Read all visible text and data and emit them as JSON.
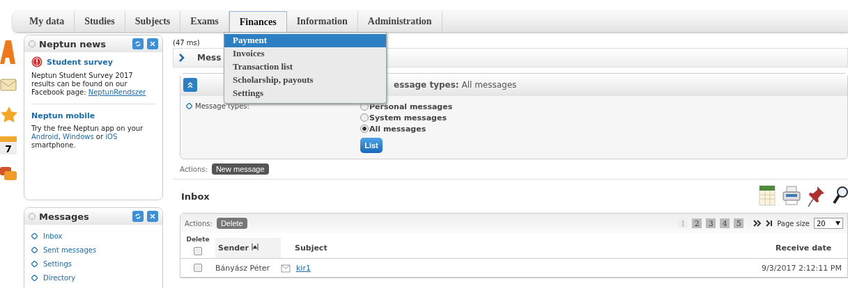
{
  "nav": {
    "tabs": [
      {
        "label": "My data",
        "selected": false
      },
      {
        "label": "Studies",
        "selected": false
      },
      {
        "label": "Subjects",
        "selected": false
      },
      {
        "label": "Exams",
        "selected": false
      },
      {
        "label": "Finances",
        "selected": true
      },
      {
        "label": "Information",
        "selected": false
      },
      {
        "label": "Administration",
        "selected": false
      }
    ],
    "dropdown": [
      {
        "label": "Payment",
        "selected": true
      },
      {
        "label": "Invoices",
        "selected": false
      },
      {
        "label": "Transaction list",
        "selected": false
      },
      {
        "label": "Scholarship, payouts",
        "selected": false
      },
      {
        "label": "Settings",
        "selected": false
      }
    ]
  },
  "side_icons": {
    "calendar_day": "7"
  },
  "news_box": {
    "title": "Neptun news",
    "items": [
      {
        "kind": "alert",
        "title": "Student survey",
        "text": "Neptun Student Survey 2017 results can be found on our Facebook page: ",
        "link": "NeptunRendszer"
      },
      {
        "kind": "plain",
        "title": "Neptun mobile",
        "parts": [
          "Try the free Neptun app on your ",
          "Android",
          ", ",
          "Windows",
          " or ",
          "iOS",
          " smartphone."
        ]
      }
    ]
  },
  "messages_box": {
    "title": "Messages",
    "links": [
      "Inbox",
      "Sent messages",
      "Settings",
      "Directory"
    ]
  },
  "timing": "(47 ms)",
  "panel_title": "Mess",
  "filter": {
    "summary_label": "essage types:",
    "summary_value": "All messages",
    "label": "Message types:",
    "options": [
      {
        "label": "Personal messages",
        "selected": false
      },
      {
        "label": "System messages",
        "selected": false
      },
      {
        "label": "All messages",
        "selected": true
      }
    ],
    "button": "List"
  },
  "actions_label": "Actions:",
  "new_message": "New message",
  "inbox": {
    "title": "Inbox",
    "actions_label": "Actions:",
    "delete_button": "Delete",
    "pages": [
      {
        "label": "1",
        "selected": true
      },
      {
        "label": "2",
        "selected": false
      },
      {
        "label": "3",
        "selected": false
      },
      {
        "label": "4",
        "selected": false
      },
      {
        "label": "5",
        "selected": false
      }
    ],
    "page_size_label": "Page size",
    "page_size": "20",
    "select_all_checked": false,
    "columns": {
      "delete": "Delete",
      "sender": "Sender",
      "subject": "Subject",
      "date": "Receive date"
    },
    "rows": [
      {
        "checked": false,
        "sender": "Bányász Péter",
        "subject": "kir1",
        "date": "9/3/2017 2:12:11 PM"
      }
    ]
  }
}
